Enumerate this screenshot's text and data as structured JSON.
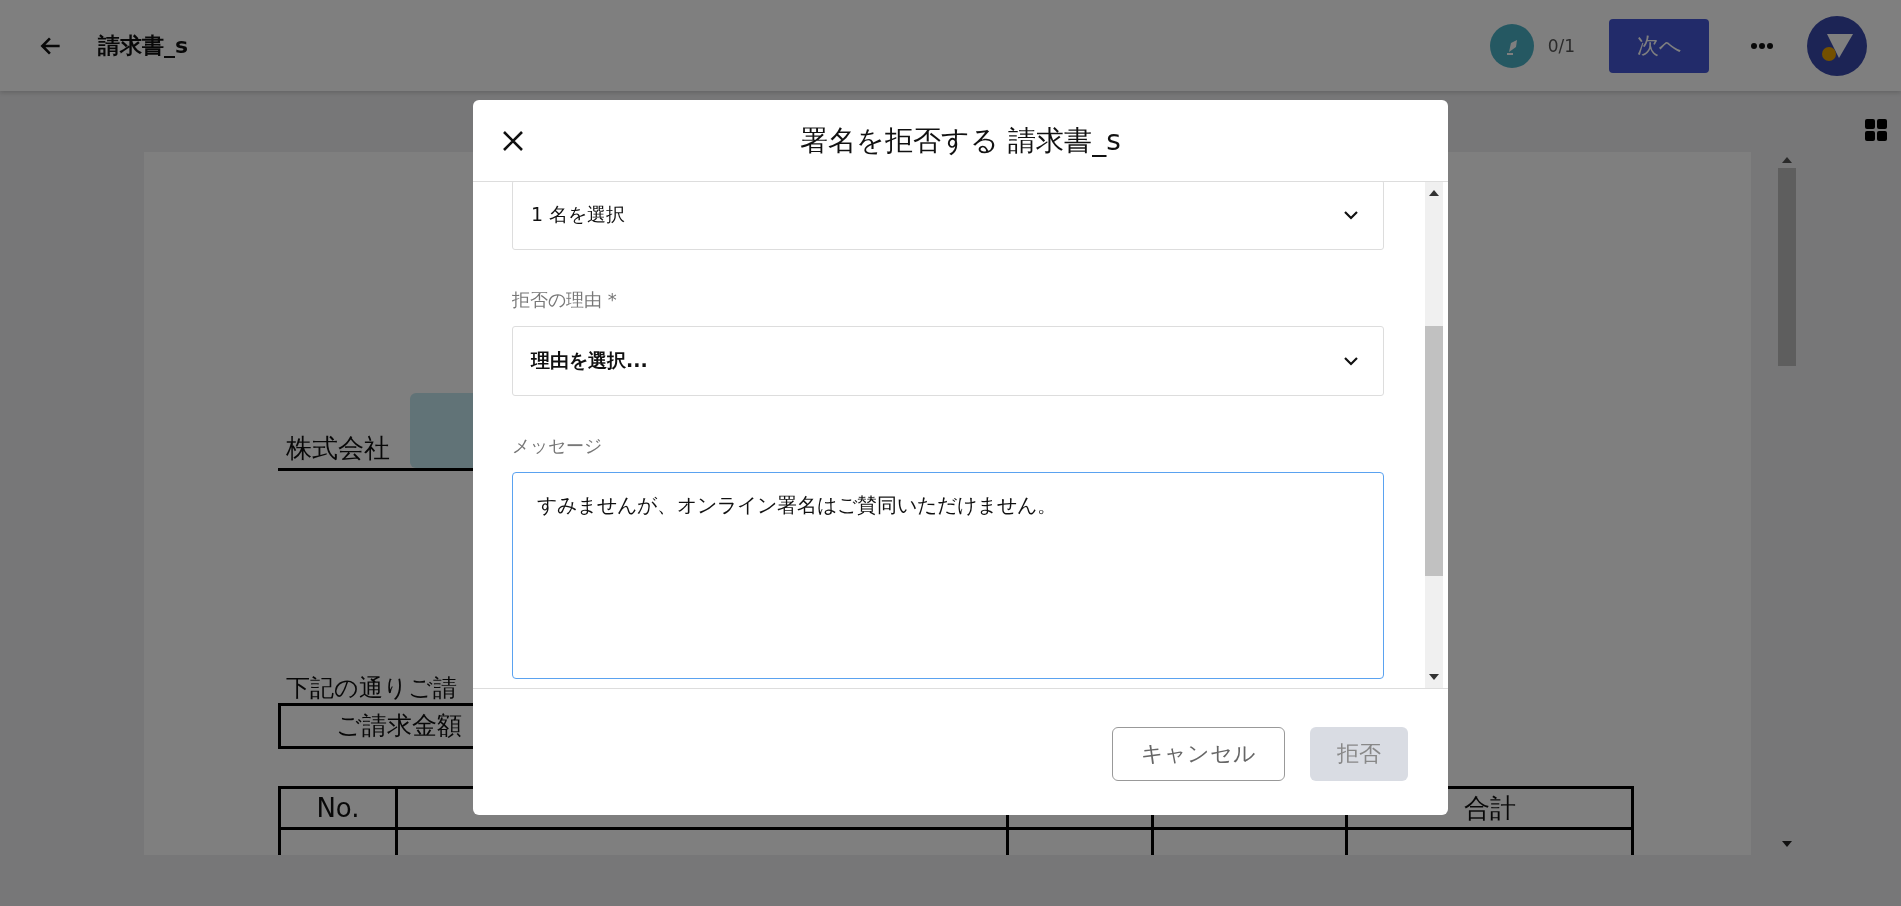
{
  "top_bar": {
    "title": "請求書_s",
    "progress": "0/1",
    "next_button": "次へ"
  },
  "document": {
    "company": "株式会社",
    "intro": "下記の通りご請",
    "amount_label": "ご請求金額",
    "table": {
      "columns": [
        "No.",
        "合計"
      ]
    }
  },
  "dialog": {
    "title": "署名を拒否する 請求書_s",
    "fields": [
      {
        "kind": "select",
        "value": "1 名を選択",
        "bold": false,
        "focused": false
      },
      {
        "kind": "select",
        "label": "拒否の理由 *",
        "value": "理由を選択...",
        "bold": true,
        "focused": false
      },
      {
        "kind": "textarea",
        "label": "メッセージ",
        "value": "すみませんが、オンライン署名はご賛同いただけません。",
        "bold": false,
        "focused": true
      }
    ],
    "buttons": [
      {
        "label": "キャンセル",
        "disabled": false
      },
      {
        "label": "拒否",
        "disabled": true
      }
    ]
  }
}
